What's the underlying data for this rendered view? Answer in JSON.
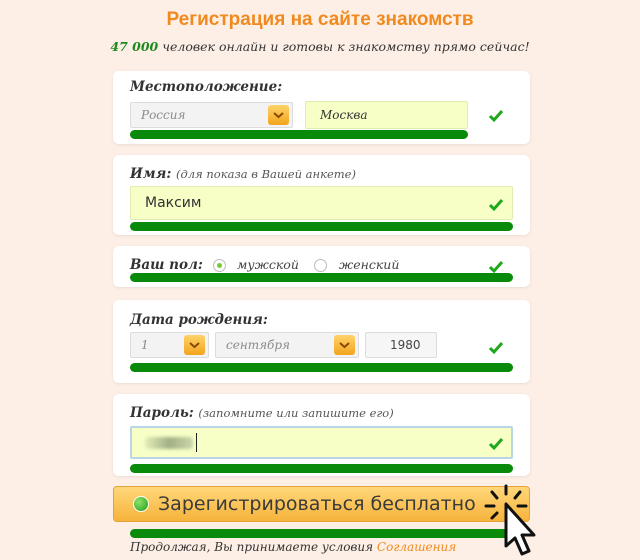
{
  "header": {
    "title": "Регистрация на сайте знакомств",
    "online_count": "47 000",
    "subtitle_rest": "человек онлайн и готовы к знакомству прямо сейчас!"
  },
  "location": {
    "label": "Местоположение:",
    "country": "Россия",
    "city": "Москва"
  },
  "name": {
    "label": "Имя:",
    "hint": "(для показа в Вашей анкете)",
    "value": "Максим"
  },
  "gender": {
    "label": "Ваш пол:",
    "options": [
      "мужской",
      "женский"
    ],
    "selected": "мужской"
  },
  "birth": {
    "label": "Дата рождения:",
    "day": "1",
    "month": "сентября",
    "year": "1980"
  },
  "password": {
    "label": "Пароль:",
    "hint": "(запомните или запишите его)"
  },
  "register": {
    "label": "Зарегистрироваться бесплатно"
  },
  "footer": {
    "text": "Продолжая, Вы принимаете условия",
    "link": "Соглашения"
  },
  "colors": {
    "accent": "#f08a1e",
    "valid_bar": "#0a8a0a",
    "check": "#1ea81e",
    "input_bg": "#f7ffc7",
    "page_bg": "#fdefe6"
  },
  "icons": [
    "check-icon",
    "chevron-down-icon",
    "radio-icon",
    "cursor-hand-icon"
  ]
}
